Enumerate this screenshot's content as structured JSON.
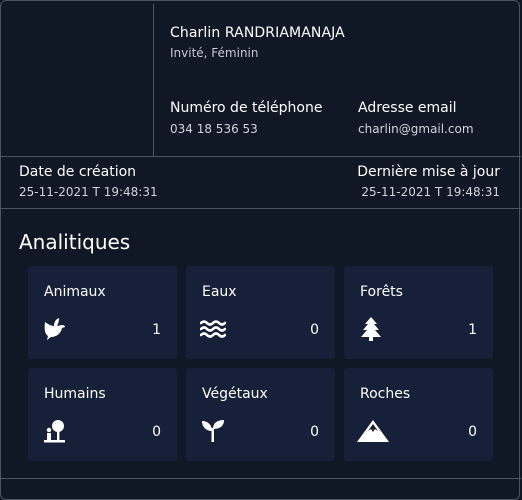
{
  "profile": {
    "name": "Charlin RANDRIAMANAJA",
    "role": "Invité, Féminin",
    "phone_label": "Numéro de téléphone",
    "phone_value": "034 18 536 53",
    "email_label": "Adresse email",
    "email_value": "charlin@gmail.com",
    "created_label": "Date de création",
    "created_value": "25-11-2021 T 19:48:31",
    "updated_label": "Dernière mise à jour",
    "updated_value": "25-11-2021 T 19:48:31"
  },
  "analytics": {
    "title": "Analitiques",
    "tiles": [
      {
        "label": "Animaux",
        "count": "1",
        "icon": "dove-icon"
      },
      {
        "label": "Eaux",
        "count": "0",
        "icon": "water-icon"
      },
      {
        "label": "Forêts",
        "count": "1",
        "icon": "tree-icon"
      },
      {
        "label": "Humains",
        "count": "0",
        "icon": "human-tree-icon"
      },
      {
        "label": "Végétaux",
        "count": "0",
        "icon": "seedling-icon"
      },
      {
        "label": "Roches",
        "count": "0",
        "icon": "mountain-icon"
      }
    ]
  },
  "colors": {
    "background": "#0f1623",
    "tile": "#162038",
    "border": "#4a5566"
  }
}
